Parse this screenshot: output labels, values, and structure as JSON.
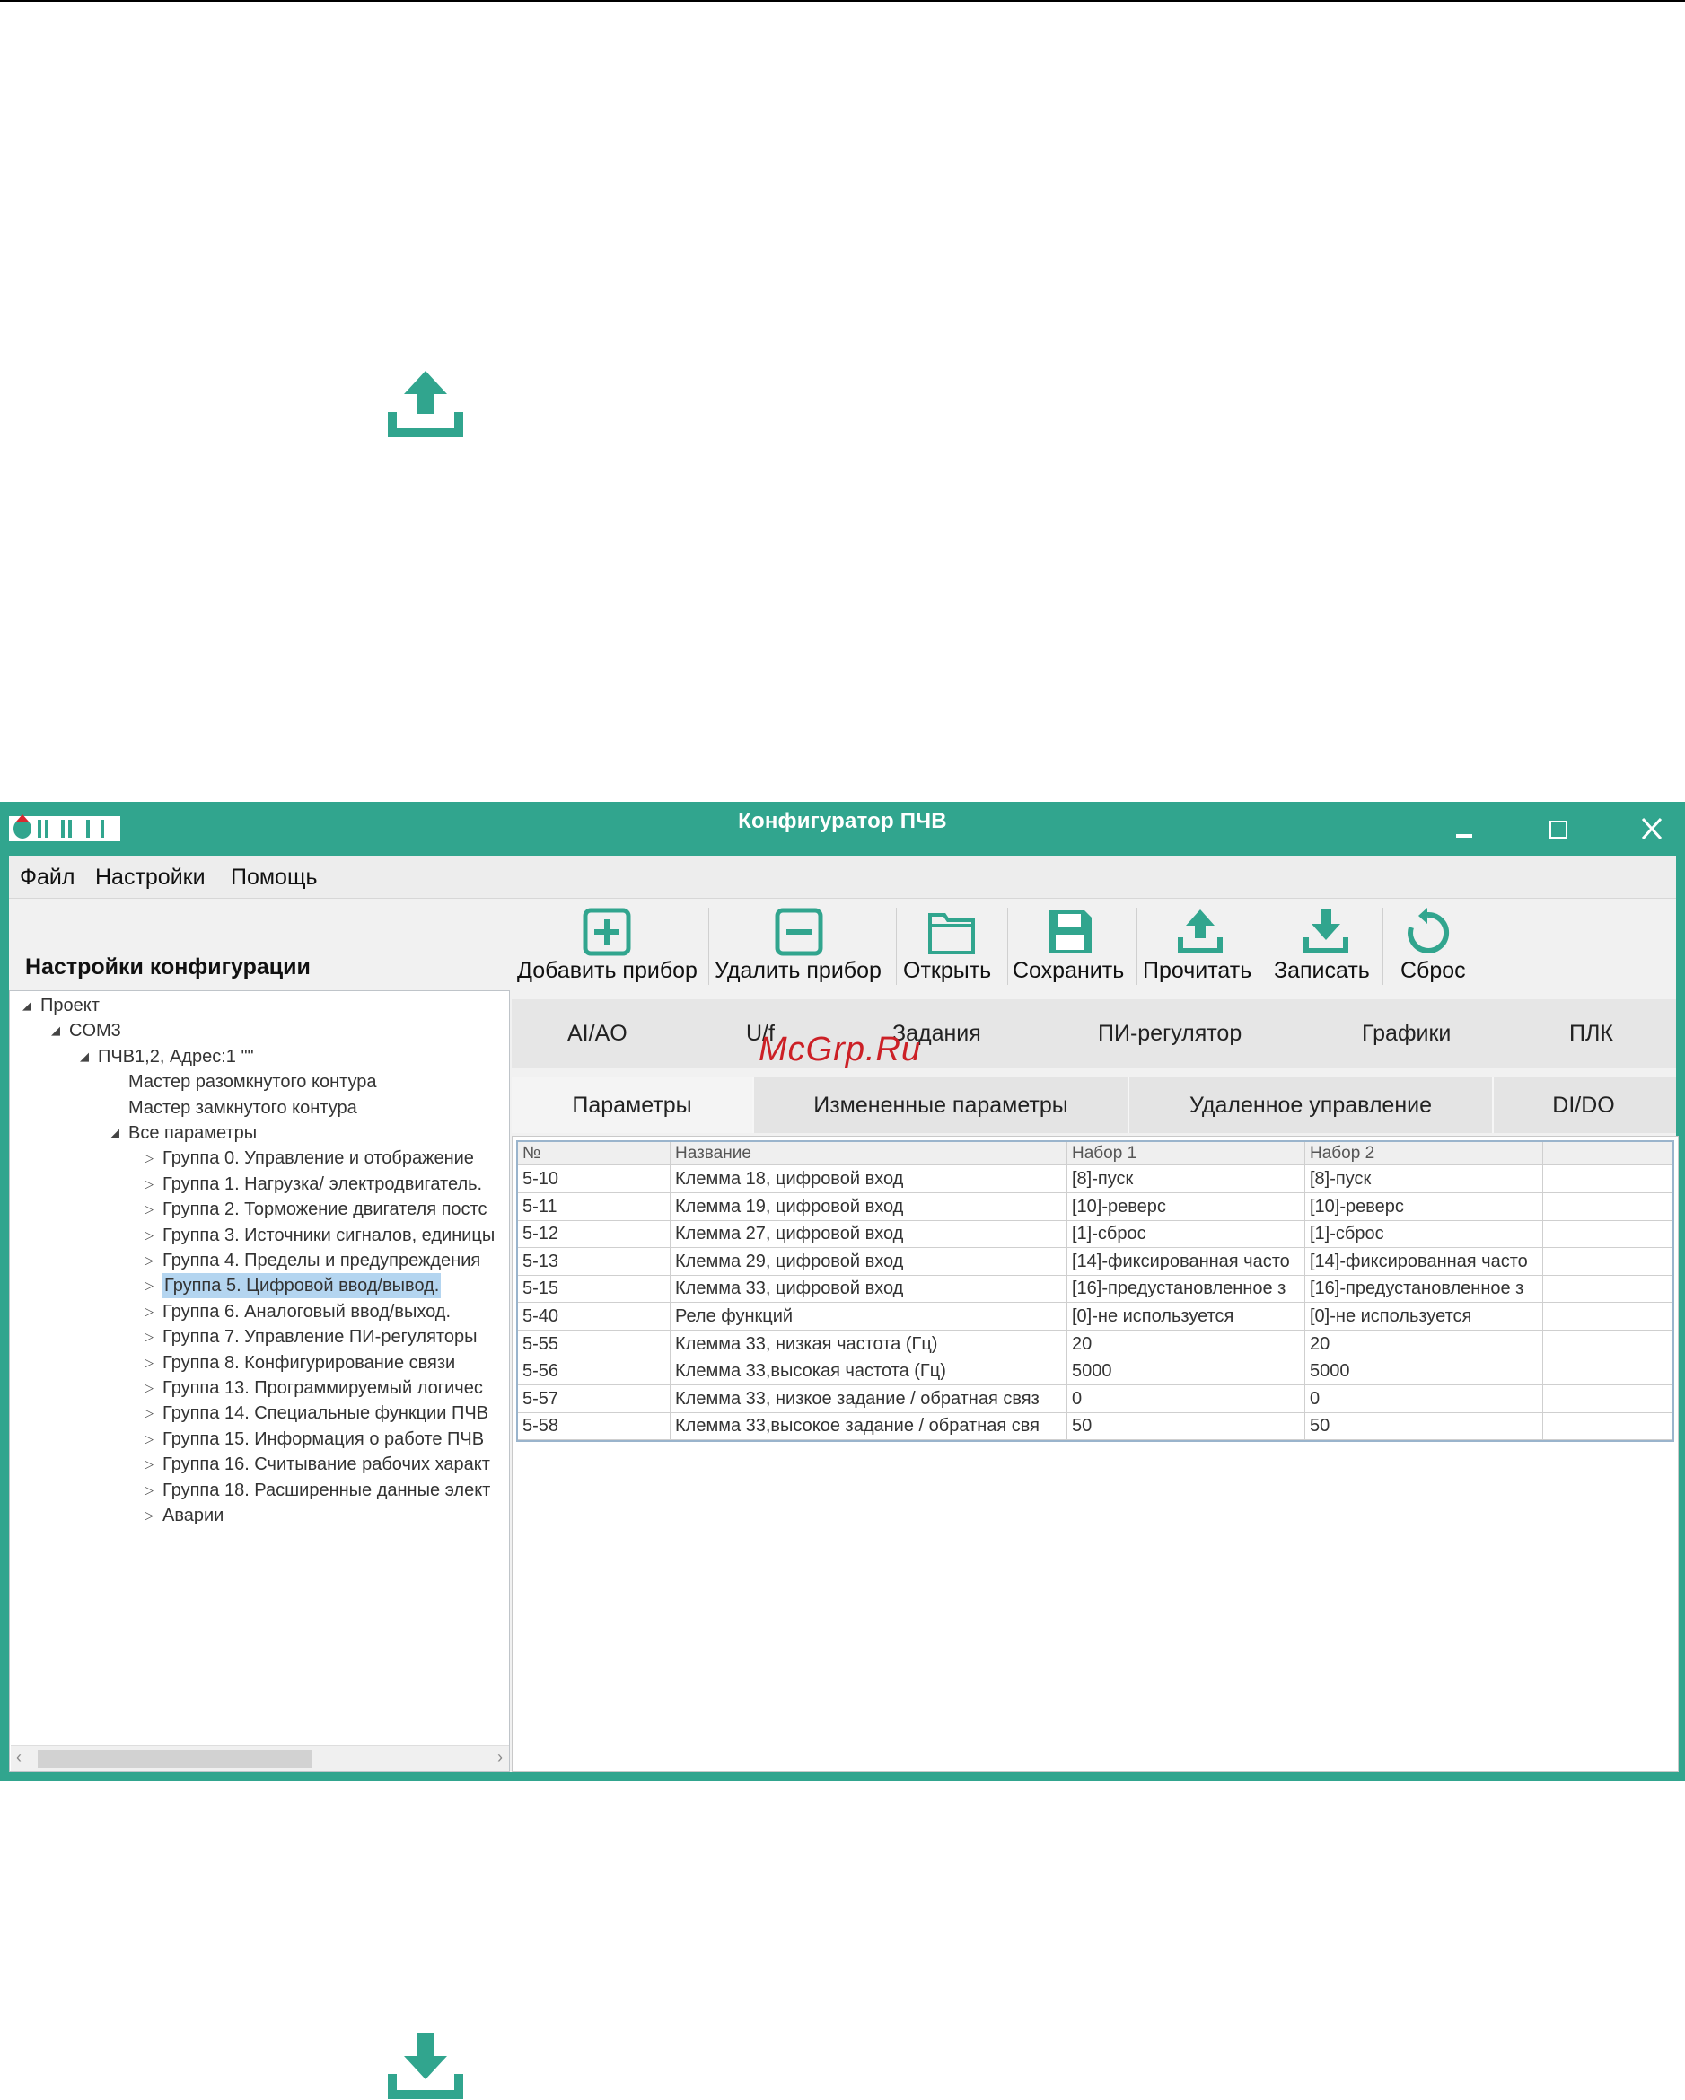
{
  "window": {
    "title": "Конфигуратор ПЧВ",
    "logo_text": "ОВЕН",
    "accent_color": "#31a58e",
    "controls": [
      "minimize-icon",
      "maximize-icon",
      "close-icon"
    ]
  },
  "menu": {
    "items": [
      "Файл",
      "Настройки",
      "Помощь"
    ]
  },
  "left_panel": {
    "title": "Настройки конфигурации",
    "tree": [
      {
        "label": "Проект",
        "level": 0,
        "expander": "expanded"
      },
      {
        "label": "COM3",
        "level": 1,
        "expander": "expanded"
      },
      {
        "label": "ПЧВ1,2, Адрес:1 \"\"",
        "level": 2,
        "expander": "expanded"
      },
      {
        "label": "Мастер разомкнутого контура",
        "level": 3,
        "expander": "none"
      },
      {
        "label": "Мастер замкнутого контура",
        "level": 3,
        "expander": "none"
      },
      {
        "label": "Все параметры",
        "level": 3,
        "expander": "expanded"
      },
      {
        "label": "Группа 0. Управление и отображение",
        "level": 4,
        "expander": "collapsed"
      },
      {
        "label": "Группа 1. Нагрузка/ электродвигатель.",
        "level": 4,
        "expander": "collapsed"
      },
      {
        "label": "Группа 2. Торможение двигателя постс",
        "level": 4,
        "expander": "collapsed"
      },
      {
        "label": "Группа 3. Источники сигналов, единицы",
        "level": 4,
        "expander": "collapsed"
      },
      {
        "label": "Группа 4. Пределы и предупреждения",
        "level": 4,
        "expander": "collapsed"
      },
      {
        "label": "Группа 5. Цифровой ввод/вывод.",
        "level": 4,
        "expander": "collapsed",
        "selected": true
      },
      {
        "label": "Группа 6. Аналоговый ввод/выход.",
        "level": 4,
        "expander": "collapsed"
      },
      {
        "label": "Группа 7. Управление ПИ-регуляторы",
        "level": 4,
        "expander": "collapsed"
      },
      {
        "label": "Группа 8. Конфигурирование связи",
        "level": 4,
        "expander": "collapsed"
      },
      {
        "label": "Группа 13. Программируемый логичес",
        "level": 4,
        "expander": "collapsed"
      },
      {
        "label": "Группа 14. Специальные функции ПЧВ",
        "level": 4,
        "expander": "collapsed"
      },
      {
        "label": "Группа 15. Информация о работе ПЧВ",
        "level": 4,
        "expander": "collapsed"
      },
      {
        "label": "Группа 16. Считывание рабочих характ",
        "level": 4,
        "expander": "collapsed"
      },
      {
        "label": "Группа 18. Расширенные данные элект",
        "level": 4,
        "expander": "collapsed"
      },
      {
        "label": "Аварии",
        "level": 4,
        "expander": "collapsed"
      }
    ],
    "scroll_left": "‹",
    "scroll_right": "›"
  },
  "toolbar": [
    {
      "label": "Добавить прибор",
      "icon": "add-device-icon"
    },
    {
      "label": "Удалить прибор",
      "icon": "remove-device-icon"
    },
    {
      "label": "Открыть",
      "icon": "folder-open-icon"
    },
    {
      "label": "Сохранить",
      "icon": "save-icon"
    },
    {
      "label": "Прочитать",
      "icon": "upload-icon"
    },
    {
      "label": "Записать",
      "icon": "download-icon"
    },
    {
      "label": "Сброс",
      "icon": "reset-icon"
    }
  ],
  "tabs_top": [
    "AI/AO",
    "U/f",
    "Задания",
    "ПИ-регулятор",
    "Графики",
    "ПЛК"
  ],
  "tabs_sub": {
    "items": [
      "Параметры",
      "Измененные параметры",
      "Удаленное управление",
      "DI/DO"
    ],
    "active": 0
  },
  "table": {
    "columns": [
      "№",
      "Название",
      "Набор 1",
      "Набор 2"
    ],
    "rows": [
      [
        "5-10",
        "Клемма 18, цифровой вход",
        "[8]-пуск",
        "[8]-пуск"
      ],
      [
        "5-11",
        "Клемма 19, цифровой вход",
        "[10]-реверс",
        "[10]-реверс"
      ],
      [
        "5-12",
        "Клемма 27, цифровой вход",
        "[1]-сброс",
        "[1]-сброс"
      ],
      [
        "5-13",
        "Клемма 29, цифровой вход",
        "[14]-фиксированная часто",
        "[14]-фиксированная часто"
      ],
      [
        "5-15",
        "Клемма 33, цифровой вход",
        "[16]-предустановленное з",
        "[16]-предустановленное з"
      ],
      [
        "5-40",
        "Реле функций",
        "[0]-не используется",
        "[0]-не используется"
      ],
      [
        "5-55",
        "Клемма 33, низкая частота (Гц)",
        "20",
        "20"
      ],
      [
        "5-56",
        "Клемма 33,высокая частота (Гц)",
        "5000",
        "5000"
      ],
      [
        "5-57",
        "Клемма 33, низкое задание / обратная связ",
        "0",
        "0"
      ],
      [
        "5-58",
        "Клемма 33,высокое задание / обратная свя",
        "50",
        "50"
      ]
    ]
  },
  "watermark": "McGrp.Ru",
  "page_icons": [
    "upload-icon",
    "download-icon"
  ]
}
